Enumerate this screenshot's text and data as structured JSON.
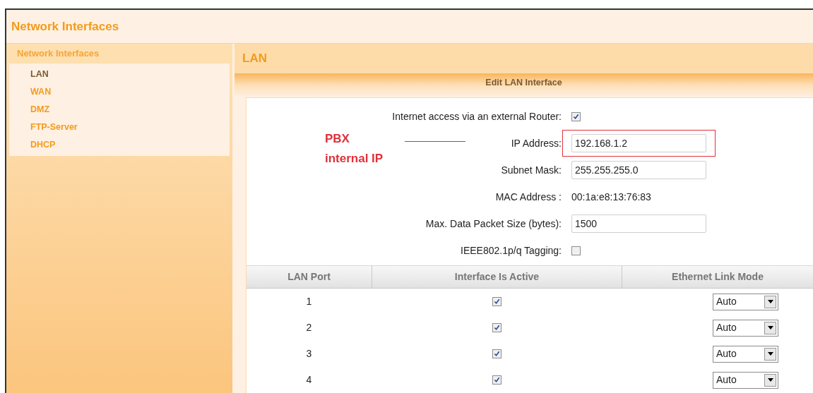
{
  "header": {
    "title": "Network Interfaces"
  },
  "sidebar": {
    "heading": "Network Interfaces",
    "items": [
      {
        "label": "LAN",
        "selected": true
      },
      {
        "label": "WAN",
        "selected": false
      },
      {
        "label": "DMZ",
        "selected": false
      },
      {
        "label": "FTP-Server",
        "selected": false
      },
      {
        "label": "DHCP",
        "selected": false
      }
    ]
  },
  "main": {
    "title": "LAN",
    "section_title": "Edit LAN Interface",
    "form": [
      {
        "kind": "checkbox",
        "label": "Internet access via an external Router:",
        "checked": true
      },
      {
        "kind": "field",
        "label": "IP Address:",
        "value": "192.168.1.2",
        "highlighted": true
      },
      {
        "kind": "field",
        "label": "Subnet Mask:",
        "value": "255.255.255.0",
        "highlighted": false
      },
      {
        "kind": "text",
        "label": "MAC Address :",
        "value": "00:1a:e8:13:76:83"
      },
      {
        "kind": "field",
        "label": "Max. Data Packet Size (bytes):",
        "value": "1500",
        "highlighted": false
      },
      {
        "kind": "checkbox",
        "label": "IEEE802.1p/q Tagging:",
        "checked": false
      }
    ],
    "annotation": {
      "lines": [
        "PBX",
        "internal IP"
      ]
    },
    "table": {
      "columns": [
        "LAN Port",
        "Interface Is Active",
        "Ethernet Link Mode"
      ],
      "rows": [
        {
          "port": "1",
          "active": true,
          "mode": "Auto"
        },
        {
          "port": "2",
          "active": true,
          "mode": "Auto"
        },
        {
          "port": "3",
          "active": true,
          "mode": "Auto"
        },
        {
          "port": "4",
          "active": true,
          "mode": "Auto"
        }
      ]
    }
  }
}
